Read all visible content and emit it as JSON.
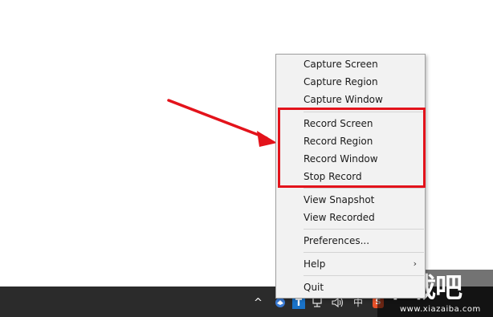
{
  "menu": {
    "items": [
      {
        "label": "Capture Screen"
      },
      {
        "label": "Capture Region"
      },
      {
        "label": "Capture Window"
      },
      {
        "label": "Record Screen"
      },
      {
        "label": "Record Region"
      },
      {
        "label": "Record Window"
      },
      {
        "label": "Stop Record"
      },
      {
        "label": "View Snapshot"
      },
      {
        "label": "View Recorded"
      },
      {
        "label": "Preferences..."
      },
      {
        "label": "Help",
        "submenu_indicator": "›"
      },
      {
        "label": "Quit"
      }
    ]
  },
  "taskbar": {
    "tray_chevron": "^",
    "tray_t_label": "T",
    "tray_ime_label": "中",
    "tray_sogou_label": "S",
    "icons": [
      "bird-icon",
      "t-app-icon",
      "network-icon",
      "volume-icon",
      "ime-icon",
      "sogou-icon"
    ]
  },
  "watermark": {
    "main": "下载吧",
    "sub": "www.xiazaiba.com"
  },
  "annotation": {
    "arrow_color": "#e3131b",
    "highlight_color": "#e3131b"
  }
}
